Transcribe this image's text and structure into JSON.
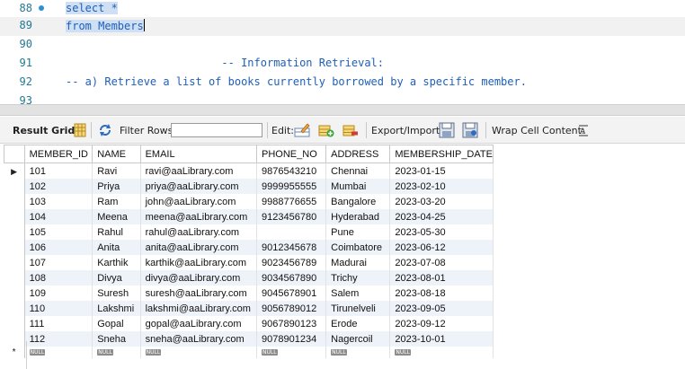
{
  "editor": {
    "lines": [
      {
        "num": "88",
        "text": "select *",
        "marker": true,
        "selected": true,
        "active": false
      },
      {
        "num": "89",
        "text": "from Members",
        "marker": false,
        "selected": true,
        "active": true
      },
      {
        "num": "90",
        "text": "",
        "marker": false,
        "selected": false,
        "active": false
      },
      {
        "num": "91",
        "text": "                        -- Information Retrieval:",
        "marker": false,
        "selected": false,
        "active": false
      },
      {
        "num": "92",
        "text": "-- a) Retrieve a list of books currently borrowed by a specific member.",
        "marker": false,
        "selected": false,
        "active": false
      },
      {
        "num": "93",
        "text": "",
        "marker": false,
        "selected": false,
        "active": false
      }
    ]
  },
  "toolbar": {
    "result_grid_label": "Result Grid",
    "filter_rows_label": "Filter Rows:",
    "filter_value": "",
    "edit_label": "Edit:",
    "export_import_label": "Export/Import:",
    "wrap_cell_label": "Wrap Cell Content:"
  },
  "grid": {
    "columns": [
      "MEMBER_ID",
      "NAME",
      "EMAIL",
      "PHONE_NO",
      "ADDRESS",
      "MEMBERSHIP_DATE"
    ],
    "rows": [
      [
        "101",
        "Ravi",
        "ravi@aaLibrary.com",
        "9876543210",
        "Chennai",
        "2023-01-15"
      ],
      [
        "102",
        "Priya",
        "priya@aaLibrary.com",
        "9999955555",
        "Mumbai",
        "2023-02-10"
      ],
      [
        "103",
        "Ram",
        "john@aaLibrary.com",
        "9988776655",
        "Bangalore",
        "2023-03-20"
      ],
      [
        "104",
        "Meena",
        "meena@aaLibrary.com",
        "9123456780",
        "Hyderabad",
        "2023-04-25"
      ],
      [
        "105",
        "Rahul",
        "rahul@aaLibrary.com",
        "",
        "Pune",
        "2023-05-30"
      ],
      [
        "106",
        "Anita",
        "anita@aaLibrary.com",
        "9012345678",
        "Coimbatore",
        "2023-06-12"
      ],
      [
        "107",
        "Karthik",
        "karthik@aaLibrary.com",
        "9023456789",
        "Madurai",
        "2023-07-08"
      ],
      [
        "108",
        "Divya",
        "divya@aaLibrary.com",
        "9034567890",
        "Trichy",
        "2023-08-01"
      ],
      [
        "109",
        "Suresh",
        "suresh@aaLibrary.com",
        "9045678901",
        "Salem",
        "2023-08-18"
      ],
      [
        "110",
        "Lakshmi",
        "lakshmi@aaLibrary.com",
        "9056789012",
        "Tirunelveli",
        "2023-09-05"
      ],
      [
        "111",
        "Gopal",
        "gopal@aaLibrary.com",
        "9067890123",
        "Erode",
        "2023-09-12"
      ],
      [
        "112",
        "Sneha",
        "sneha@aaLibrary.com",
        "9078901234",
        "Nagercoil",
        "2023-10-01"
      ]
    ],
    "null_label": "NULL",
    "new_row_marker": "*",
    "current_row_marker": "▶"
  },
  "colors": {
    "keyword": "#1f5fb8",
    "selection": "#cfe0f4",
    "row_alt": "#eef3fa",
    "line_number": "#237893"
  },
  "icons": [
    "result-grid-icon",
    "refresh-icon",
    "edit-row-icon",
    "add-row-icon",
    "delete-row-icon",
    "export-icon",
    "import-icon",
    "wrap-cell-icon"
  ]
}
